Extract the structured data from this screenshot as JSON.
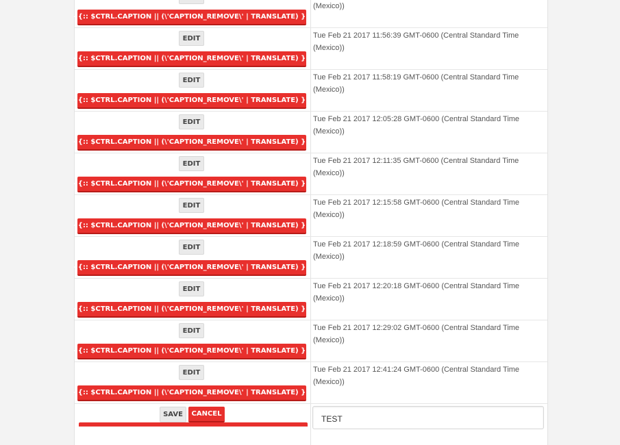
{
  "labels": {
    "edit": "EDIT",
    "remove": "{{:: $CTRL.CAPTION || (\\'CAPTION_REMOVE\\' | TRANSLATE) }}",
    "save": "SAVE",
    "cancel": "CANCEL"
  },
  "rows": [
    {
      "date": "(Mexico))"
    },
    {
      "date": "Tue Feb 21 2017 11:56:39 GMT-0600 (Central Standard Time (Mexico))"
    },
    {
      "date": "Tue Feb 21 2017 11:58:19 GMT-0600 (Central Standard Time (Mexico))"
    },
    {
      "date": "Tue Feb 21 2017 12:05:28 GMT-0600 (Central Standard Time (Mexico))"
    },
    {
      "date": "Tue Feb 21 2017 12:11:35 GMT-0600 (Central Standard Time (Mexico))"
    },
    {
      "date": "Tue Feb 21 2017 12:15:58 GMT-0600 (Central Standard Time (Mexico))"
    },
    {
      "date": "Tue Feb 21 2017 12:18:59 GMT-0600 (Central Standard Time (Mexico))"
    },
    {
      "date": "Tue Feb 21 2017 12:20:18 GMT-0600 (Central Standard Time (Mexico))"
    },
    {
      "date": "Tue Feb 21 2017 12:29:02 GMT-0600 (Central Standard Time (Mexico))"
    },
    {
      "date": "Tue Feb 21 2017 12:41:24 GMT-0600 (Central Standard Time (Mexico))"
    }
  ],
  "edit_row": {
    "input_value": "TEST"
  }
}
